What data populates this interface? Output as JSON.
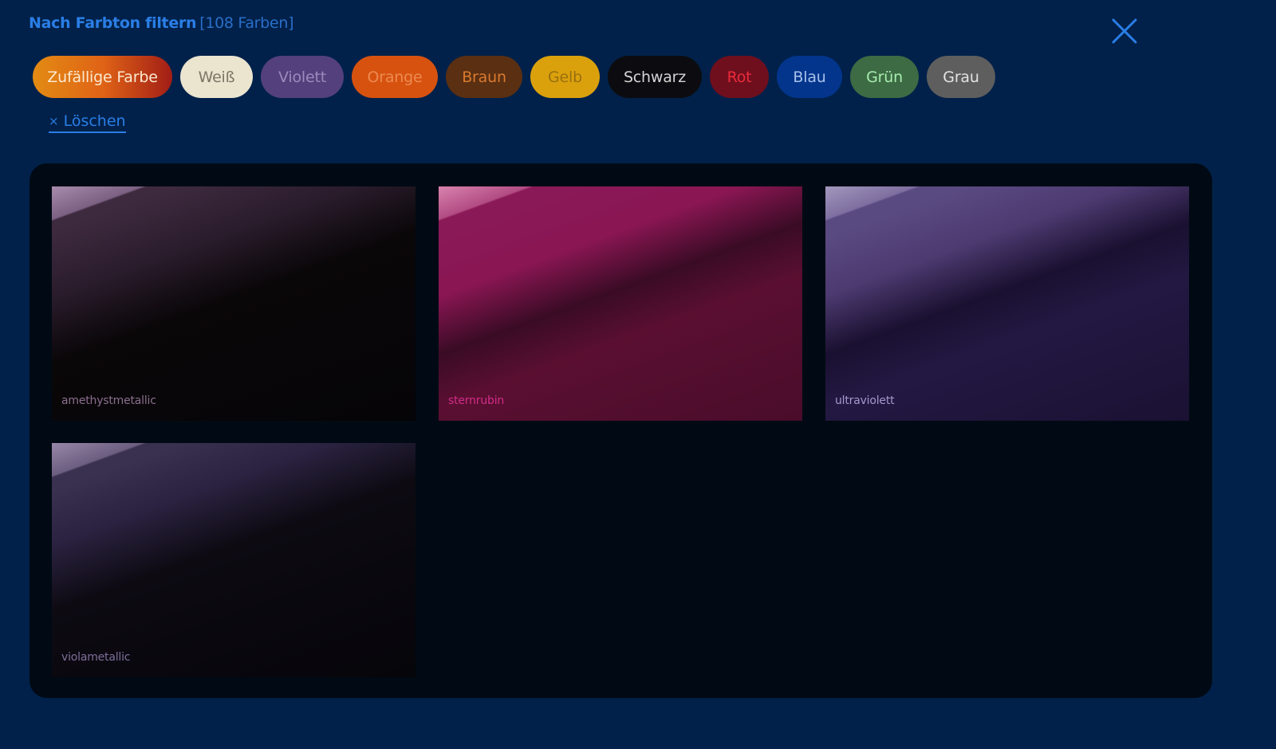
{
  "header": {
    "title": "Nach Farbton filtern",
    "count": "[108 Farben]",
    "close_icon": "close-icon"
  },
  "colors": {
    "accent": "#2a7ee6",
    "background": "#01214a",
    "panel": "#010a14"
  },
  "filters": [
    {
      "label": "Zufällige Farbe"
    },
    {
      "label": "Weiß"
    },
    {
      "label": "Violett"
    },
    {
      "label": "Orange"
    },
    {
      "label": "Braun"
    },
    {
      "label": "Gelb"
    },
    {
      "label": "Schwarz"
    },
    {
      "label": "Rot"
    },
    {
      "label": "Blau"
    },
    {
      "label": "Grün"
    },
    {
      "label": "Grau"
    }
  ],
  "clear": {
    "icon": "×",
    "label": "Löschen"
  },
  "swatches": [
    {
      "name": "amethystmetallic"
    },
    {
      "name": "sternrubin"
    },
    {
      "name": "ultraviolett"
    },
    {
      "name": "violametallic"
    }
  ]
}
